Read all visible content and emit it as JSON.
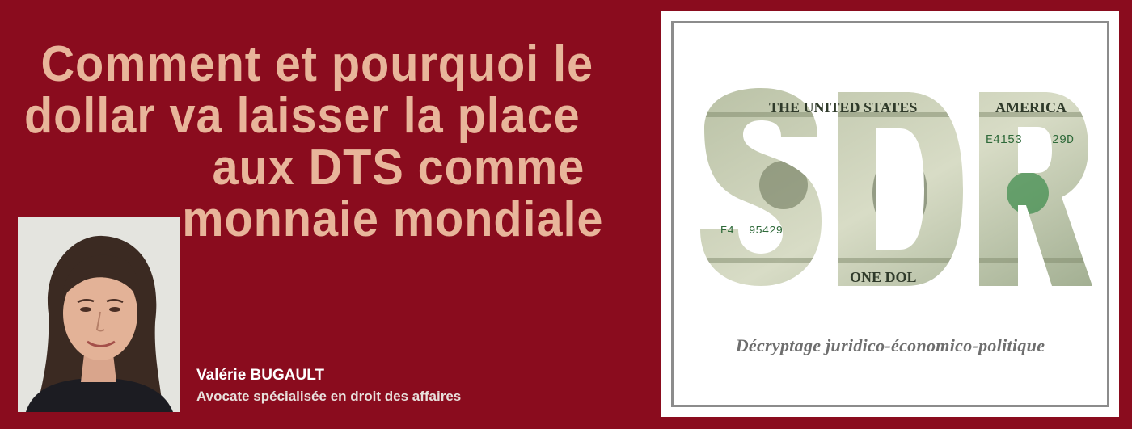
{
  "headline": {
    "line1": "Comment et pourquoi le",
    "line2": "dollar va laisser la place",
    "line3": "aux DTS comme",
    "line4": "monnaie mondiale"
  },
  "author": {
    "name": "Valérie BUGAULT",
    "role": "Avocate spécialisée en droit des affaires"
  },
  "card": {
    "logo_text": "SDR",
    "note_texts": [
      "THE UNITED STATES",
      "AMERICA",
      "E4153",
      "29D",
      "E4",
      "95429",
      "ONE DOL"
    ],
    "subtitle": "Décryptage juridico-économico-politique"
  },
  "colors": {
    "background": "#8a0c1e",
    "headline": "#e8b59a",
    "banknote": "#9aa88a"
  }
}
